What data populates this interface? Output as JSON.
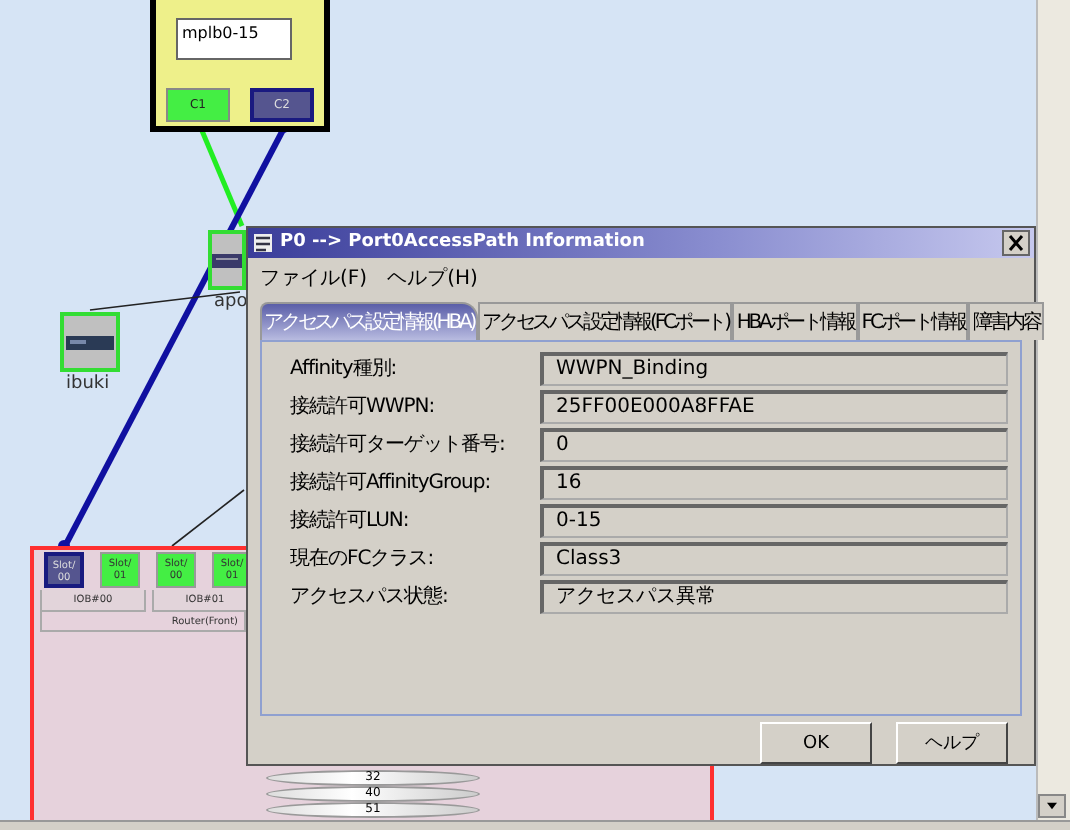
{
  "storage": {
    "field": "mplb0-15",
    "ports": [
      {
        "label": "C1",
        "selected": false
      },
      {
        "label": "C2",
        "selected": true
      }
    ]
  },
  "nodes": [
    {
      "label": "apo",
      "kind": "switch"
    },
    {
      "label": "ibuki",
      "kind": "server"
    }
  ],
  "router": {
    "slots": [
      {
        "name": "Slot/",
        "number": "00",
        "selected": true
      },
      {
        "name": "Slot/",
        "number": "01",
        "selected": false
      },
      {
        "name": "Slot/",
        "number": "00",
        "selected": false
      },
      {
        "name": "Slot/",
        "number": "01",
        "selected": false
      }
    ],
    "boards": [
      "IOB#00",
      "IOB#01"
    ],
    "label": "Router(Front)"
  },
  "disk": [
    "32",
    "40",
    "51"
  ],
  "dialog": {
    "title": "P0 --> Port0AccessPath Information",
    "menu": [
      "ファイル(F)",
      "ヘルプ(H)"
    ],
    "tabs": [
      {
        "label": "アクセスパス設定情報(HBA)",
        "selected": true
      },
      {
        "label": "アクセスパス設定情報(FCポート)",
        "selected": false
      },
      {
        "label": "HBAポート情報",
        "selected": false
      },
      {
        "label": "FCポート情報",
        "selected": false
      },
      {
        "label": "障害内容",
        "selected": false
      }
    ],
    "fields": [
      {
        "label": "Affinity種別:",
        "value": "WWPN_Binding"
      },
      {
        "label": "接続許可WWPN:",
        "value": "25FF00E000A8FFAE"
      },
      {
        "label": "接続許可ターゲット番号:",
        "value": "0"
      },
      {
        "label": "接続許可AffinityGroup:",
        "value": "16"
      },
      {
        "label": "接続許可LUN:",
        "value": "0-15"
      },
      {
        "label": "現在のFCクラス:",
        "value": "Class3"
      },
      {
        "label": "アクセスパス状態:",
        "value": "アクセスパス異常"
      }
    ],
    "buttons": [
      "OK",
      "ヘルプ"
    ]
  }
}
